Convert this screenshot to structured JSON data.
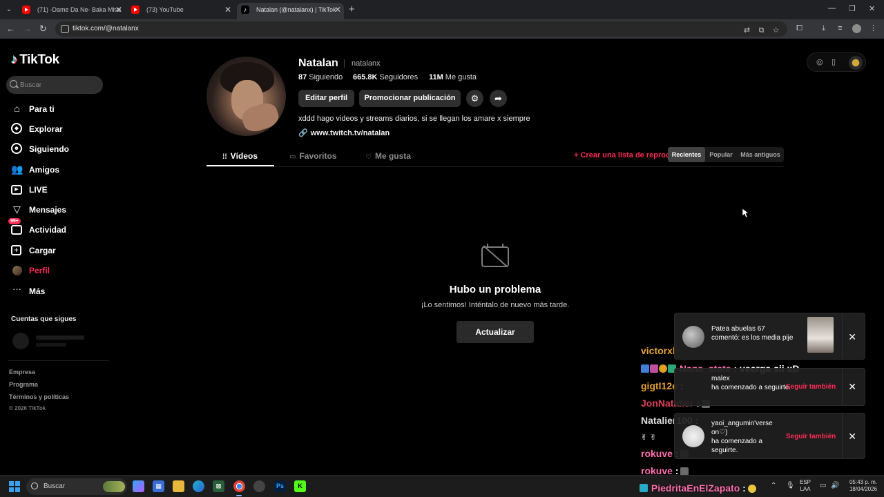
{
  "browser": {
    "tabs": [
      {
        "title": "(71) -Dame Da Ne- Baka Mitai",
        "favicon": "youtube-icon"
      },
      {
        "title": "(73) YouTube",
        "favicon": "youtube-icon"
      },
      {
        "title": "Natalan (@natalanx) | TikTok",
        "favicon": "tiktok-icon",
        "active": true
      }
    ],
    "url": "tiktok.com/@natalanx"
  },
  "sidebar": {
    "logo": "TikTok",
    "search_placeholder": "Buscar",
    "items": [
      {
        "label": "Para ti",
        "icon": "home-icon"
      },
      {
        "label": "Explorar",
        "icon": "compass-icon"
      },
      {
        "label": "Siguiendo",
        "icon": "following-icon"
      },
      {
        "label": "Amigos",
        "icon": "friends-icon"
      },
      {
        "label": "LIVE",
        "icon": "live-icon"
      },
      {
        "label": "Mensajes",
        "icon": "messages-icon"
      },
      {
        "label": "Actividad",
        "icon": "activity-icon",
        "badge": "99+"
      },
      {
        "label": "Cargar",
        "icon": "upload-icon"
      },
      {
        "label": "Perfil",
        "icon": "profile-avatar-icon",
        "active": true
      },
      {
        "label": "Más",
        "icon": "more-icon"
      }
    ],
    "following_title": "Cuentas que sigues",
    "footer": {
      "links": [
        "Empresa",
        "Programa",
        "Términos y políticas"
      ],
      "copyright": "© 2026 TikTok"
    }
  },
  "profile": {
    "name": "Natalan",
    "username": "natalanx",
    "stats": [
      {
        "value": "87",
        "label": "Siguiendo"
      },
      {
        "value": "665.8K",
        "label": "Seguidores"
      },
      {
        "value": "11M",
        "label": "Me gusta"
      }
    ],
    "buttons": {
      "edit": "Editar perfil",
      "promote": "Promocionar publicación"
    },
    "bio": "xddd hago videos y streams diarios, si se llegan los amare x siempre",
    "link": "www.twitch.tv/natalan"
  },
  "tabs": {
    "items": [
      {
        "label": "Vídeos",
        "icon": "grid-icon",
        "active": true
      },
      {
        "label": "Favoritos",
        "icon": "bookmark-icon"
      },
      {
        "label": "Me gusta",
        "icon": "heart-icon"
      }
    ],
    "create_list": "+ Crear una lista de reproducción",
    "sort": [
      "Recientes",
      "Popular",
      "Más antiguos"
    ],
    "sort_active": "Recientes"
  },
  "error": {
    "title": "Hubo un problema",
    "message": "¡Lo sentimos! Inténtalo de nuevo más tarde.",
    "button": "Actualizar"
  },
  "chat": [
    {
      "user": "victorxk1",
      "color": "#e8a33a",
      "text": ""
    },
    {
      "user": "Nana_state",
      "color": "#ff6fae",
      "text": "veerga sii xD"
    },
    {
      "user": "gigtl12e",
      "color": "#e8a33a",
      "text": ""
    },
    {
      "user": "JonNatalier",
      "color": "#e0425a",
      "text": ""
    },
    {
      "user": "Natalier100",
      "color": "#dddddd",
      "text": ""
    },
    {
      "user": "rokuve",
      "color": "#ff6fae",
      "text": ""
    },
    {
      "user": "rokuve",
      "color": "#ff6fae",
      "text": ""
    },
    {
      "user": "PiedritaEnElZapato",
      "color": "#ff6fae",
      "text": ""
    }
  ],
  "notifications": [
    {
      "title": "Patea abuelas 67",
      "body": "comentó: es los media pije"
    },
    {
      "title": "malex",
      "body": "ha comenzado a seguirte.",
      "action": "Seguir también"
    },
    {
      "title": "yaoi_angumin'verse on♡)",
      "body": "ha comenzado a seguirte.",
      "action": "Seguir también"
    }
  ],
  "taskbar": {
    "search": "Buscar",
    "lang_top": "ESP",
    "lang_bottom": "LAA",
    "time": "05:43 p. m.",
    "date": "18/04/2026"
  }
}
